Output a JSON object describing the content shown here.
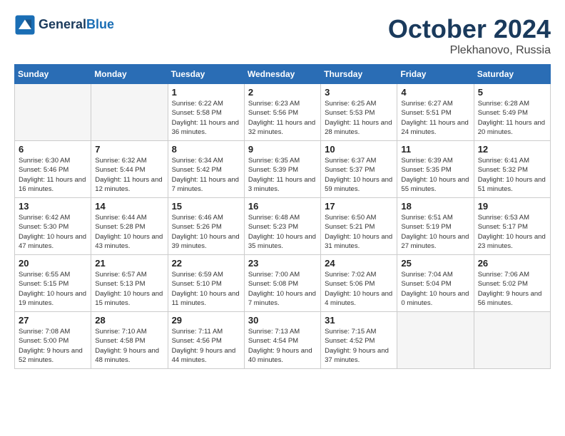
{
  "header": {
    "logo_line1": "General",
    "logo_line2": "Blue",
    "month": "October 2024",
    "location": "Plekhanovo, Russia"
  },
  "weekdays": [
    "Sunday",
    "Monday",
    "Tuesday",
    "Wednesday",
    "Thursday",
    "Friday",
    "Saturday"
  ],
  "weeks": [
    [
      {
        "day": "",
        "info": ""
      },
      {
        "day": "",
        "info": ""
      },
      {
        "day": "1",
        "info": "Sunrise: 6:22 AM\nSunset: 5:58 PM\nDaylight: 11 hours and 36 minutes."
      },
      {
        "day": "2",
        "info": "Sunrise: 6:23 AM\nSunset: 5:56 PM\nDaylight: 11 hours and 32 minutes."
      },
      {
        "day": "3",
        "info": "Sunrise: 6:25 AM\nSunset: 5:53 PM\nDaylight: 11 hours and 28 minutes."
      },
      {
        "day": "4",
        "info": "Sunrise: 6:27 AM\nSunset: 5:51 PM\nDaylight: 11 hours and 24 minutes."
      },
      {
        "day": "5",
        "info": "Sunrise: 6:28 AM\nSunset: 5:49 PM\nDaylight: 11 hours and 20 minutes."
      }
    ],
    [
      {
        "day": "6",
        "info": "Sunrise: 6:30 AM\nSunset: 5:46 PM\nDaylight: 11 hours and 16 minutes."
      },
      {
        "day": "7",
        "info": "Sunrise: 6:32 AM\nSunset: 5:44 PM\nDaylight: 11 hours and 12 minutes."
      },
      {
        "day": "8",
        "info": "Sunrise: 6:34 AM\nSunset: 5:42 PM\nDaylight: 11 hours and 7 minutes."
      },
      {
        "day": "9",
        "info": "Sunrise: 6:35 AM\nSunset: 5:39 PM\nDaylight: 11 hours and 3 minutes."
      },
      {
        "day": "10",
        "info": "Sunrise: 6:37 AM\nSunset: 5:37 PM\nDaylight: 10 hours and 59 minutes."
      },
      {
        "day": "11",
        "info": "Sunrise: 6:39 AM\nSunset: 5:35 PM\nDaylight: 10 hours and 55 minutes."
      },
      {
        "day": "12",
        "info": "Sunrise: 6:41 AM\nSunset: 5:32 PM\nDaylight: 10 hours and 51 minutes."
      }
    ],
    [
      {
        "day": "13",
        "info": "Sunrise: 6:42 AM\nSunset: 5:30 PM\nDaylight: 10 hours and 47 minutes."
      },
      {
        "day": "14",
        "info": "Sunrise: 6:44 AM\nSunset: 5:28 PM\nDaylight: 10 hours and 43 minutes."
      },
      {
        "day": "15",
        "info": "Sunrise: 6:46 AM\nSunset: 5:26 PM\nDaylight: 10 hours and 39 minutes."
      },
      {
        "day": "16",
        "info": "Sunrise: 6:48 AM\nSunset: 5:23 PM\nDaylight: 10 hours and 35 minutes."
      },
      {
        "day": "17",
        "info": "Sunrise: 6:50 AM\nSunset: 5:21 PM\nDaylight: 10 hours and 31 minutes."
      },
      {
        "day": "18",
        "info": "Sunrise: 6:51 AM\nSunset: 5:19 PM\nDaylight: 10 hours and 27 minutes."
      },
      {
        "day": "19",
        "info": "Sunrise: 6:53 AM\nSunset: 5:17 PM\nDaylight: 10 hours and 23 minutes."
      }
    ],
    [
      {
        "day": "20",
        "info": "Sunrise: 6:55 AM\nSunset: 5:15 PM\nDaylight: 10 hours and 19 minutes."
      },
      {
        "day": "21",
        "info": "Sunrise: 6:57 AM\nSunset: 5:13 PM\nDaylight: 10 hours and 15 minutes."
      },
      {
        "day": "22",
        "info": "Sunrise: 6:59 AM\nSunset: 5:10 PM\nDaylight: 10 hours and 11 minutes."
      },
      {
        "day": "23",
        "info": "Sunrise: 7:00 AM\nSunset: 5:08 PM\nDaylight: 10 hours and 7 minutes."
      },
      {
        "day": "24",
        "info": "Sunrise: 7:02 AM\nSunset: 5:06 PM\nDaylight: 10 hours and 4 minutes."
      },
      {
        "day": "25",
        "info": "Sunrise: 7:04 AM\nSunset: 5:04 PM\nDaylight: 10 hours and 0 minutes."
      },
      {
        "day": "26",
        "info": "Sunrise: 7:06 AM\nSunset: 5:02 PM\nDaylight: 9 hours and 56 minutes."
      }
    ],
    [
      {
        "day": "27",
        "info": "Sunrise: 7:08 AM\nSunset: 5:00 PM\nDaylight: 9 hours and 52 minutes."
      },
      {
        "day": "28",
        "info": "Sunrise: 7:10 AM\nSunset: 4:58 PM\nDaylight: 9 hours and 48 minutes."
      },
      {
        "day": "29",
        "info": "Sunrise: 7:11 AM\nSunset: 4:56 PM\nDaylight: 9 hours and 44 minutes."
      },
      {
        "day": "30",
        "info": "Sunrise: 7:13 AM\nSunset: 4:54 PM\nDaylight: 9 hours and 40 minutes."
      },
      {
        "day": "31",
        "info": "Sunrise: 7:15 AM\nSunset: 4:52 PM\nDaylight: 9 hours and 37 minutes."
      },
      {
        "day": "",
        "info": ""
      },
      {
        "day": "",
        "info": ""
      }
    ]
  ]
}
